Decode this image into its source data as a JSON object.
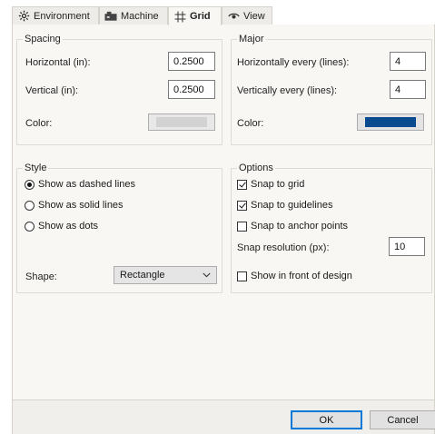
{
  "tabs": [
    {
      "label": "Environment",
      "icon": "gear-icon"
    },
    {
      "label": "Machine",
      "icon": "machine-icon"
    },
    {
      "label": "Grid",
      "icon": "grid-icon"
    },
    {
      "label": "View",
      "icon": "eye-icon"
    }
  ],
  "spacing": {
    "title": "Spacing",
    "horizontal_label": "Horizontal (in):",
    "horizontal_value": "0.2500",
    "vertical_label": "Vertical (in):",
    "vertical_value": "0.2500",
    "color_label": "Color:",
    "color": "#d2d2d2"
  },
  "major": {
    "title": "Major",
    "horizontal_label": "Horizontally every (lines):",
    "horizontal_value": "4",
    "vertical_label": "Vertically every (lines):",
    "vertical_value": "4",
    "color_label": "Color:",
    "color": "#0a4a8f"
  },
  "style": {
    "title": "Style",
    "options": [
      {
        "label": "Show as dashed lines",
        "checked": true
      },
      {
        "label": "Show as solid lines",
        "checked": false
      },
      {
        "label": "Show as dots",
        "checked": false
      }
    ],
    "shape_label": "Shape:",
    "shape_value": "Rectangle"
  },
  "options": {
    "title": "Options",
    "snap_grid": {
      "label": "Snap to grid",
      "checked": true
    },
    "snap_guidelines": {
      "label": "Snap to guidelines",
      "checked": true
    },
    "snap_anchor": {
      "label": "Snap to anchor points",
      "checked": false
    },
    "snap_res_label": "Snap resolution (px):",
    "snap_res_value": "10",
    "show_front": {
      "label": "Show in front of design",
      "checked": false
    }
  },
  "buttons": {
    "ok": "OK",
    "cancel": "Cancel"
  }
}
